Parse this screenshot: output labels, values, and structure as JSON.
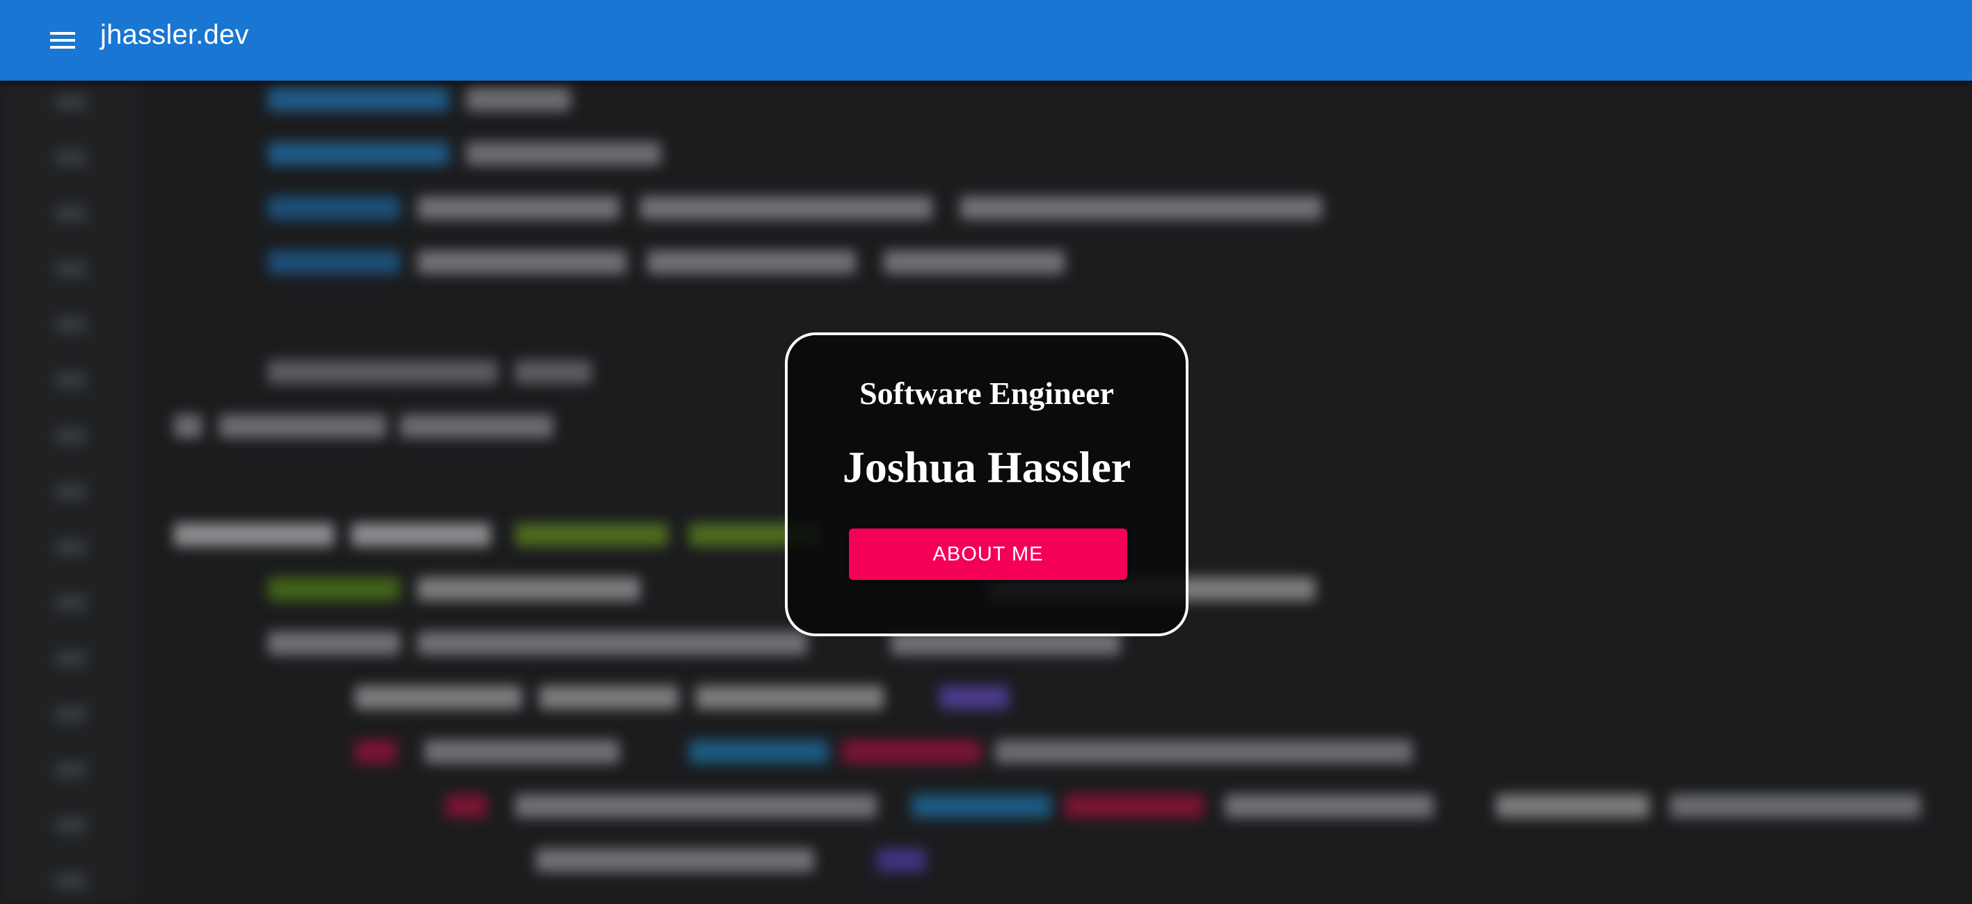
{
  "appbar": {
    "title": "jhassler.dev",
    "menu_icon": "menu-icon",
    "color": "#1976d2"
  },
  "hero": {
    "subtitle": "Software Engineer",
    "name": "Joshua Hassler",
    "button_label": "ABOUT ME",
    "button_color": "#f50057"
  },
  "background": {
    "style": "blurred code editor screenshot",
    "base_color": "#1b1c1e"
  }
}
